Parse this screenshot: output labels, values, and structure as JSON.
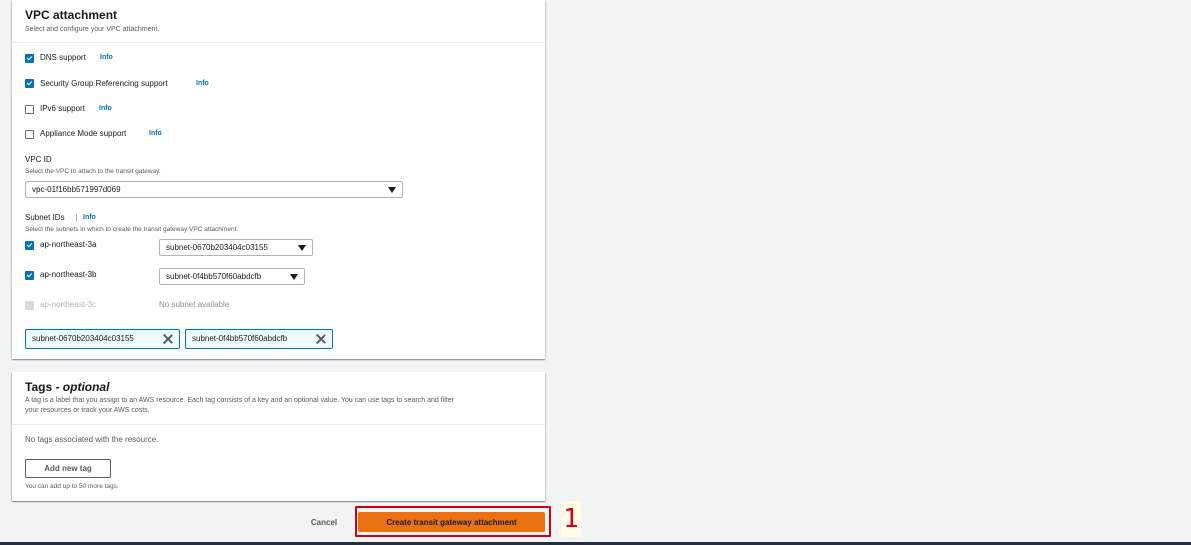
{
  "vpc_attachment": {
    "title": "VPC attachment",
    "description": "Select and configure your VPC attachment.",
    "options": [
      {
        "label": "DNS support",
        "checked": true,
        "info": "Info"
      },
      {
        "label": "Security Group Referencing support",
        "checked": true,
        "info": "Info"
      },
      {
        "label": "IPv6 support",
        "checked": false,
        "info": "Info"
      },
      {
        "label": "Appliance Mode support",
        "checked": false,
        "info": "Info"
      }
    ],
    "vpc_id": {
      "label": "VPC ID",
      "description": "Select the VPC to attach to the transit gateway.",
      "value": "vpc-01f16bb571997d069"
    },
    "subnet_ids": {
      "label": "Subnet IDs",
      "info": "Info",
      "description": "Select the subnets in which to create the transit gateway VPC attachment.",
      "zones": [
        {
          "zone": "ap-northeast-3a",
          "checked": true,
          "subnet": "subnet-0670b203404c03155"
        },
        {
          "zone": "ap-northeast-3b",
          "checked": true,
          "subnet": "subnet-0f4bb570f60abdcfb"
        },
        {
          "zone": "ap-northeast-3c",
          "checked": false,
          "disabled": true,
          "subnet_placeholder": "No subnet available"
        }
      ],
      "selected_tokens": [
        "subnet-0670b203404c03155",
        "subnet-0f4bb570f60abdcfb"
      ]
    }
  },
  "tags": {
    "title_main": "Tags - ",
    "title_optional": "optional",
    "description_line1": "A tag is a label that you assign to an AWS resource. Each tag consists of a key and an optional value. You can use tags to search and filter",
    "description_line2": "your resources or track your AWS costs.",
    "empty_text": "No tags associated with the resource.",
    "add_button": "Add new tag",
    "limit_text": "You can add up to 50 more tags."
  },
  "footer": {
    "cancel_label": "Cancel",
    "create_label": "Create transit gateway attachment",
    "step_number": "1"
  },
  "colors": {
    "accent_blue": "#0073bb",
    "primary_orange": "#ec7211",
    "highlight_red": "#d0021b"
  }
}
